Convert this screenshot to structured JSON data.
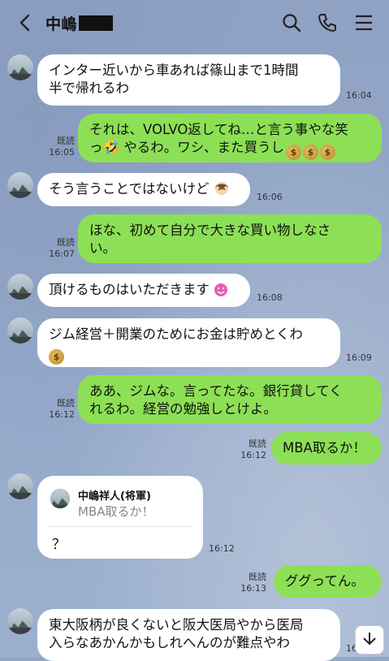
{
  "header": {
    "title": "中嶋",
    "icons": [
      "back-icon",
      "search-icon",
      "phone-icon",
      "menu-icon"
    ]
  },
  "messages": [
    {
      "side": "left",
      "text": "インター近いから車あれば篠山まで1時間\n半で帰れるわ",
      "time": "16:04"
    },
    {
      "side": "right",
      "text": "それは、VOLVO返してね…と言う事やな笑\nっ🤣 やるわ。ワシ、また買うし",
      "read": "既読",
      "time": "16:05"
    },
    {
      "side": "left",
      "text": "そう言うことではないけど",
      "time": "16:06"
    },
    {
      "side": "right",
      "text": "ほな、初めて自分で大きな買い物しなさ\nい。",
      "read": "既読",
      "time": "16:07"
    },
    {
      "side": "left",
      "text": "頂けるものはいただきます",
      "time": "16:08"
    },
    {
      "side": "left",
      "text": "ジム経営＋開業のためにお金は貯めとくわ",
      "time": "16:09"
    },
    {
      "side": "right",
      "text": "ああ、ジムな。言ってたな。銀行貸してく\nれるわ。経営の勉強しとけよ。",
      "read": "既読",
      "time": "16:12"
    },
    {
      "side": "right",
      "text": "MBA取るか！",
      "read": "既読",
      "time": "16:12"
    },
    {
      "side": "left",
      "quote_name": "中嶋祥人(将軍)",
      "quote_text": "MBA取るか！",
      "text": "？",
      "time": "16:12"
    },
    {
      "side": "right",
      "text": "ググってん。",
      "read": "既読",
      "time": "16:13"
    },
    {
      "side": "left",
      "text": "東大阪柄が良くないと阪大医局やから医局\n入らなあかんかもしれへんのが難点やわ",
      "time": "16"
    }
  ],
  "money_emoji": "$"
}
